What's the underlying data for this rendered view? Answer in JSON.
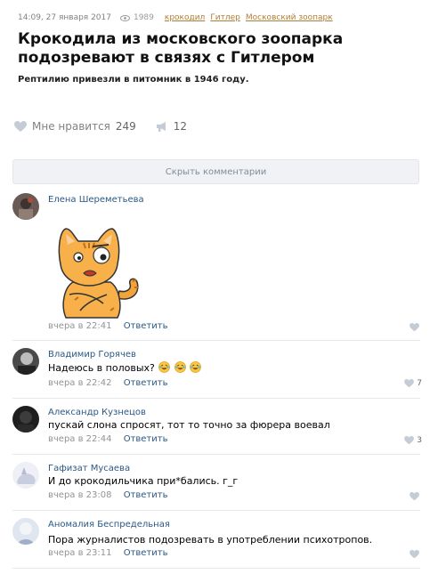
{
  "post": {
    "date": "14:09, 27 января 2017",
    "views": "1989",
    "tags": [
      "крокодил",
      "Гитлер",
      "Московский зоопарк"
    ],
    "title": "Крокодила из московского зоопарка подозревают в связях с Гитлером",
    "subtitle": "Рептилию привезли в питомник в 1946 году."
  },
  "actions": {
    "like_label": "Мне нравится",
    "like_count": "249",
    "share_count": "12"
  },
  "comments_toggle": "Скрыть комментарии",
  "comments": [
    {
      "author": "Елена Шереметьева",
      "text": "",
      "time": "вчера в 22:41",
      "reply": "Ответить",
      "likes": ""
    },
    {
      "author": "Владимир Горячев",
      "text": "Надеюсь в половых?",
      "time": "вчера в 22:42",
      "reply": "Ответить",
      "likes": "7"
    },
    {
      "author": "Александр Кузнецов",
      "text": "пускай слона спросят, тот то точно за фюрера воевал",
      "time": "вчера в 22:44",
      "reply": "Ответить",
      "likes": "3"
    },
    {
      "author": "Гафизат Мусаева",
      "text": "И до крокодильчика при*бались. г_г",
      "time": "вчера в 23:08",
      "reply": "Ответить",
      "likes": ""
    },
    {
      "author": "Аномалия Беспредельная",
      "text": "Пора журналистов подозревать в употреблении психотропов.",
      "time": "вчера в 23:11",
      "reply": "Ответить",
      "likes": ""
    }
  ],
  "icons": {
    "heart": "heart-icon",
    "share": "megaphone-icon",
    "views": "eye-icon"
  },
  "colors": {
    "link": "#2a5885",
    "tag": "#b17d37",
    "muted": "#939393"
  }
}
